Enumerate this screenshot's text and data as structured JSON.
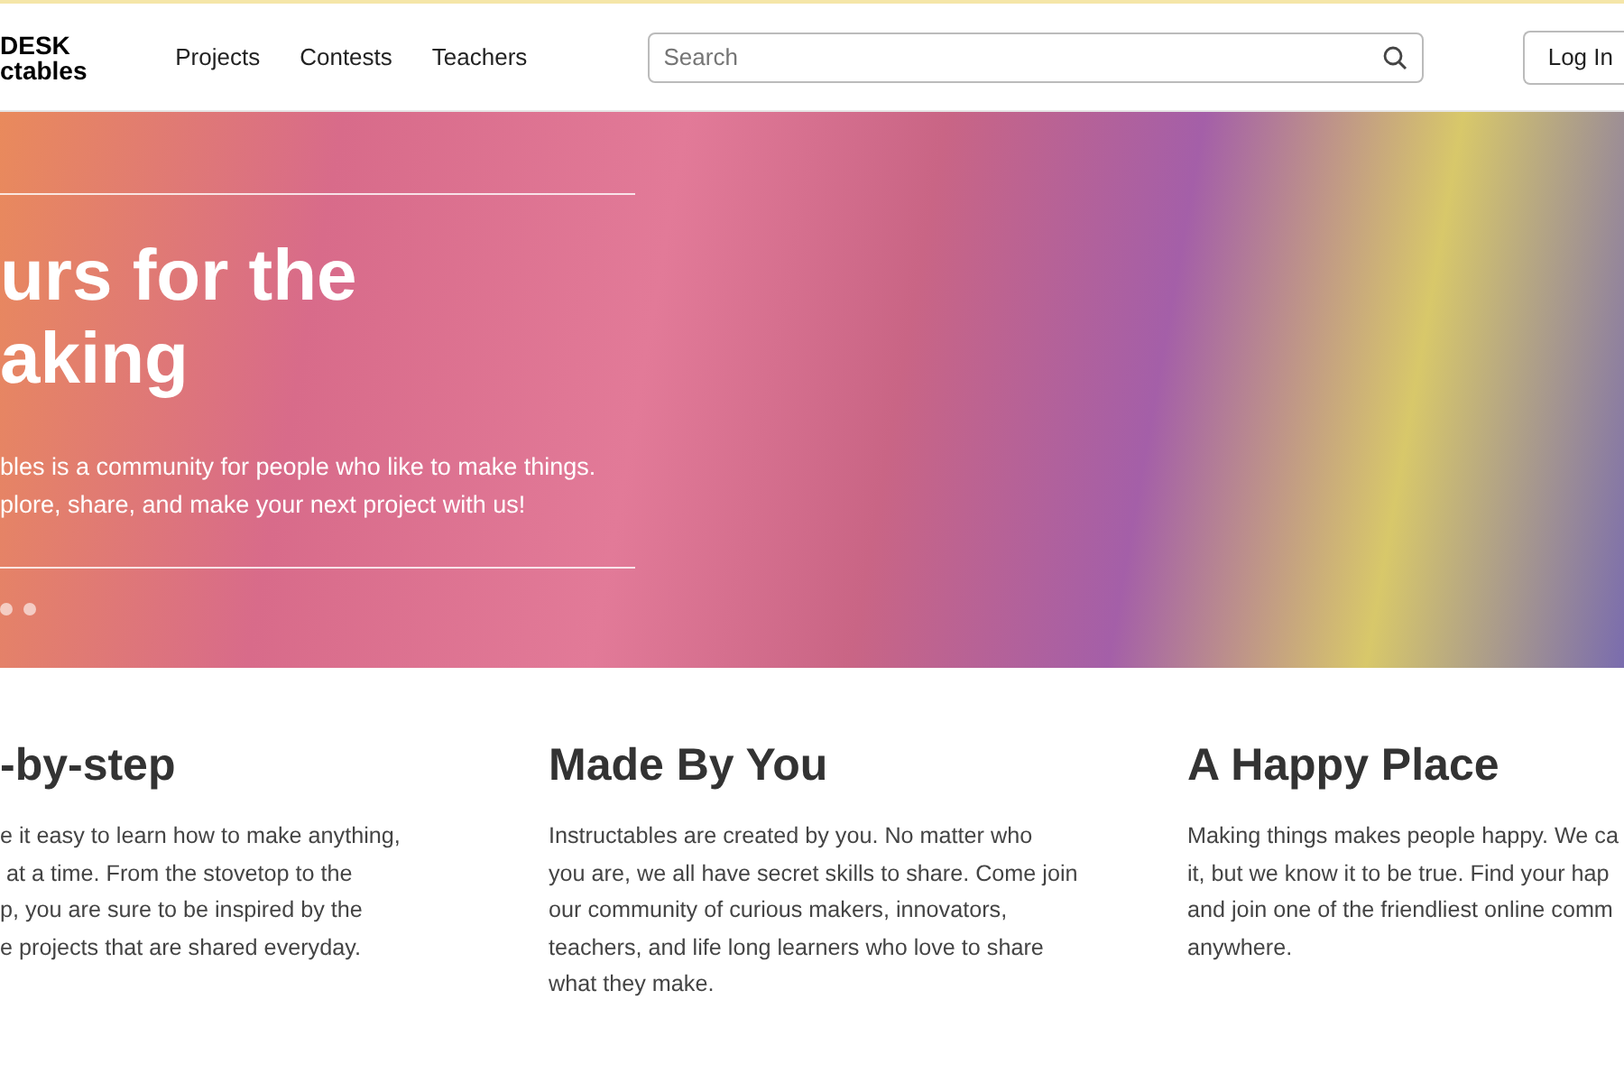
{
  "header": {
    "logo_lines": [
      "DESK",
      "ctables"
    ],
    "nav": [
      "Projects",
      "Contests",
      "Teachers"
    ],
    "search": {
      "placeholder": "Search"
    },
    "login": "Log In"
  },
  "hero": {
    "title_lines": [
      "urs for the",
      "aking"
    ],
    "subtitle_lines": [
      "bles is a community for people who like to make things.",
      "plore, share, and make your next project with us!"
    ]
  },
  "features": [
    {
      "title": "-by-step",
      "lines": [
        "e it easy to learn how to make anything,",
        " at a time. From the stovetop to the",
        "p, you are sure to be inspired by the",
        "e projects that are shared everyday."
      ]
    },
    {
      "title": "Made By You",
      "lines": [
        "Instructables are created by you. No matter who",
        "you are, we all have secret skills to share. Come join",
        "our community of curious makers, innovators,",
        "teachers, and life long learners who love to share",
        "what they make."
      ]
    },
    {
      "title": "A Happy Place",
      "lines": [
        "Making things makes people happy. We ca",
        "it, but we know it to be true. Find your hap",
        "and join one of the friendliest online comm",
        "anywhere."
      ]
    }
  ]
}
